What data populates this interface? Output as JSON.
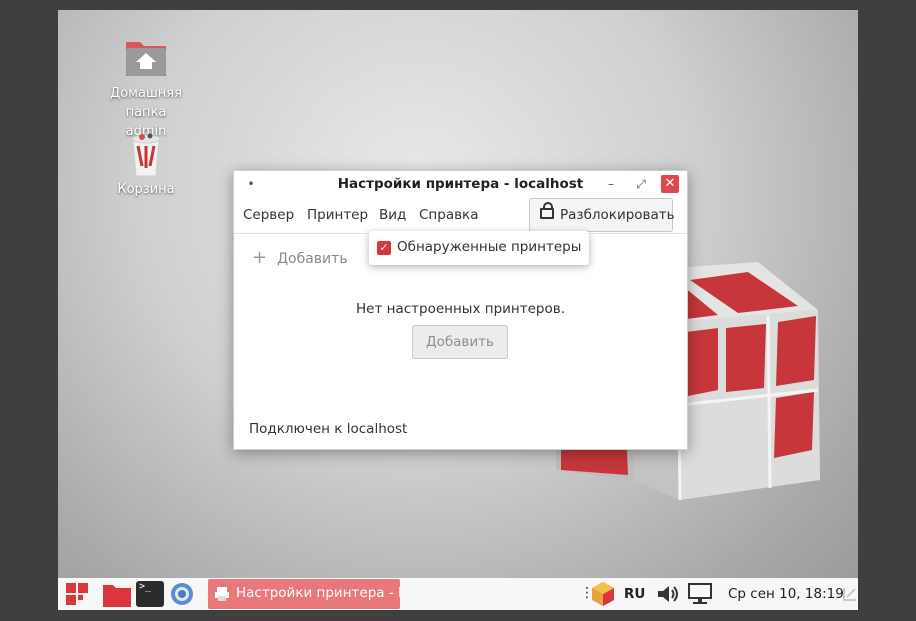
{
  "desktop": {
    "icons": [
      {
        "label_line1": "Домашняя папка",
        "label_line2": "admin",
        "icon": "home-folder-icon"
      },
      {
        "label_line1": "Корзина",
        "icon": "trash-icon"
      }
    ]
  },
  "window": {
    "title": "Настройки принтера - localhost",
    "menu": [
      "Сервер",
      "Принтер",
      "Вид",
      "Справка"
    ],
    "unlock_label": "Разблокировать",
    "toolbar_add_label": "Добавить",
    "empty_message": "Нет настроенных принтеров.",
    "add_button_label": "Добавить",
    "status": "Подключен к localhost"
  },
  "popup": {
    "item_label": "Обнаруженные принтеры",
    "checked": true
  },
  "taskbar": {
    "task_title": "Настройки принтера - l...",
    "language": "RU",
    "clock": "Ср сен 10, 18:19"
  },
  "colors": {
    "accent": "#d9363e",
    "task_active": "#e9787b"
  }
}
